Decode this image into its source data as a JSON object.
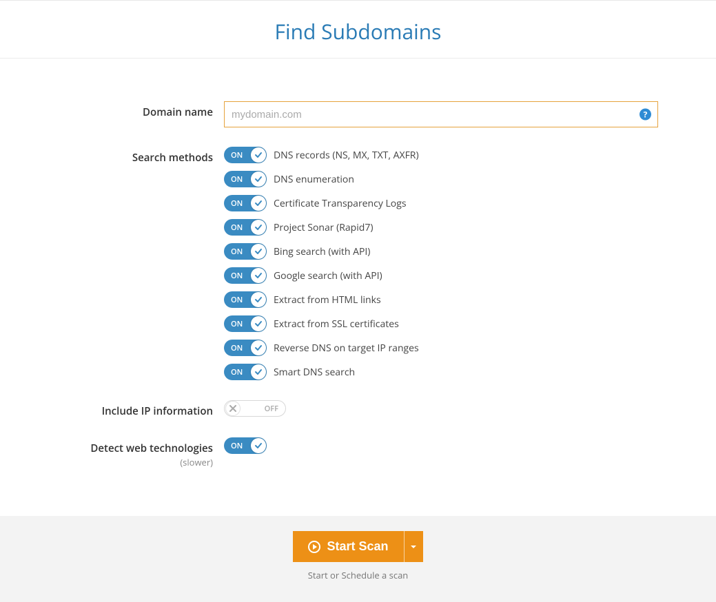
{
  "header": {
    "title": "Find Subdomains"
  },
  "form": {
    "domain": {
      "label": "Domain name",
      "placeholder": "mydomain.com",
      "value": ""
    },
    "methods": {
      "label": "Search methods",
      "toggle_on_text": "ON",
      "items": [
        {
          "label": "DNS records (NS, MX, TXT, AXFR)",
          "state": "on"
        },
        {
          "label": "DNS enumeration",
          "state": "on"
        },
        {
          "label": "Certificate Transparency Logs",
          "state": "on"
        },
        {
          "label": "Project Sonar (Rapid7)",
          "state": "on"
        },
        {
          "label": "Bing search (with API)",
          "state": "on"
        },
        {
          "label": "Google search (with API)",
          "state": "on"
        },
        {
          "label": "Extract from HTML links",
          "state": "on"
        },
        {
          "label": "Extract from SSL certificates",
          "state": "on"
        },
        {
          "label": "Reverse DNS on target IP ranges",
          "state": "on"
        },
        {
          "label": "Smart DNS search",
          "state": "on"
        }
      ]
    },
    "include_ip": {
      "label": "Include IP information",
      "state": "off",
      "state_text": "OFF"
    },
    "detect_tech": {
      "label": "Detect web technologies",
      "hint": "(slower)",
      "state": "on",
      "state_text": "ON"
    }
  },
  "footer": {
    "button": "Start Scan",
    "hint": "Start or Schedule a scan"
  },
  "colors": {
    "accent_blue": "#2a7bb5",
    "toggle_blue": "#3a8bc2",
    "button_orange": "#ed9016",
    "input_border": "#e6a23c"
  }
}
